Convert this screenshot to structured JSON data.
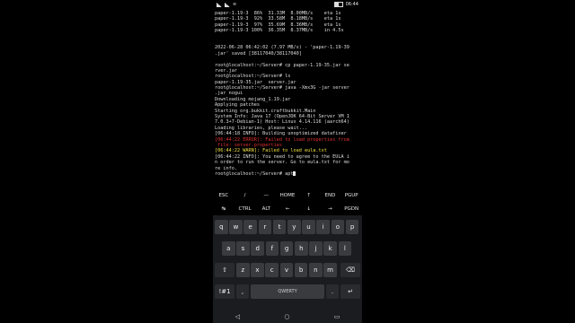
{
  "status": {
    "time": "06:44",
    "battery_level": 0.6
  },
  "terminal": {
    "lines": [
      {
        "text": "paper-1.19-3  86%  31.33M  8.00MB/s    eta 1s",
        "kind": "normal"
      },
      {
        "text": "paper-1.19-3  92%  33.58M  8.18MB/s    eta 1s",
        "kind": "normal"
      },
      {
        "text": "paper-1.19-3  97%  35.69M  8.36MB/s    eta 1s",
        "kind": "normal"
      },
      {
        "text": "paper-1.19-3 100%  36.35M  8.37MB/s    in 4.5s",
        "kind": "normal"
      },
      {
        "text": "",
        "kind": "normal"
      },
      {
        "text": "",
        "kind": "normal"
      },
      {
        "text": "2022-06-28 06:42:02 (7.97 MB/s) - 'paper-1.19-39",
        "kind": "normal"
      },
      {
        "text": ".jar' saved [38117040/38117040]",
        "kind": "normal"
      },
      {
        "text": "",
        "kind": "normal"
      },
      {
        "text": "root@localhost:~/Server# cp paper-1.19-35.jar se",
        "kind": "normal"
      },
      {
        "text": "rver.jar",
        "kind": "normal"
      },
      {
        "text": "root@localhost:~/Server# ls",
        "kind": "normal"
      },
      {
        "text": "paper-1.19-35.jar  server.jar",
        "kind": "normal"
      },
      {
        "text": "root@localhost:~/Server# java -Xmx3G -jar server",
        "kind": "normal"
      },
      {
        "text": ".jar nogui",
        "kind": "normal"
      },
      {
        "text": "Downloading mojang_1.19.jar",
        "kind": "normal"
      },
      {
        "text": "Applying patches",
        "kind": "normal"
      },
      {
        "text": "Starting org.bukkit.craftbukkit.Main",
        "kind": "normal"
      },
      {
        "text": "System Info: Java 17 (OpenJDK 64-Bit Server VM 1",
        "kind": "normal"
      },
      {
        "text": "7.0.3+7-Debian-1) Host: Linux 4.14.116 (aarch64)",
        "kind": "normal"
      },
      {
        "text": "Loading libraries, please wait...",
        "kind": "normal"
      },
      {
        "text": "[06:44:18 INFO]: Building unoptimized datafixer",
        "kind": "normal"
      },
      {
        "text": "[06:44:22 ERROR]: Failed to load properties from",
        "kind": "err"
      },
      {
        "text": " file: server.properties",
        "kind": "err"
      },
      {
        "text": "[06:44:22 WARN]: Failed to load eula.txt",
        "kind": "warn"
      },
      {
        "text": "[06:44:22 INFO]: You need to agree to the EULA i",
        "kind": "normal"
      },
      {
        "text": "n order to run the server. Go to eula.txt for mo",
        "kind": "normal"
      },
      {
        "text": "re info.",
        "kind": "normal"
      }
    ],
    "prompt": "root@localhost:~/Server# apt"
  },
  "extra_keys": {
    "row1": [
      "ESC",
      "/",
      "—",
      "HOME",
      "↑",
      "END",
      "PGUP"
    ],
    "row2": [
      "↹",
      "CTRL",
      "ALT",
      "←",
      "↓",
      "→",
      "PGDN"
    ]
  },
  "keyboard": {
    "row1": [
      "q",
      "w",
      "e",
      "r",
      "t",
      "y",
      "u",
      "i",
      "o",
      "p"
    ],
    "row2": [
      "a",
      "s",
      "d",
      "f",
      "g",
      "h",
      "j",
      "k",
      "l"
    ],
    "row3": [
      "z",
      "x",
      "c",
      "v",
      "b",
      "n",
      "m"
    ],
    "shift": "⇧",
    "backspace": "⌫",
    "symbols": "!#1",
    "comma": ",",
    "space": "QWERTY",
    "period": ".",
    "enter": "↵"
  },
  "navbar": {
    "back": "◁",
    "home": "○",
    "recents": "▭"
  }
}
